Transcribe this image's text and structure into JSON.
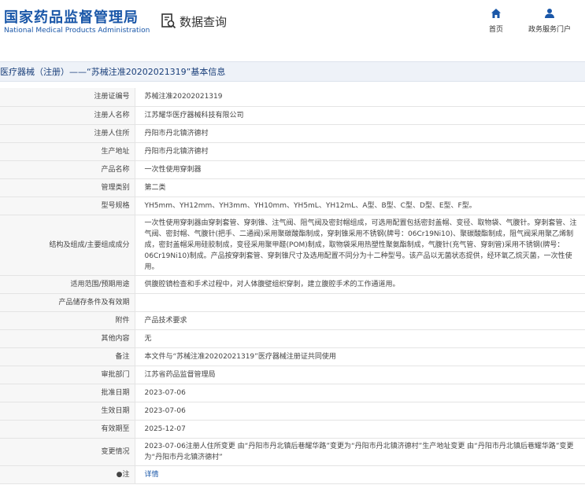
{
  "header": {
    "logo_cn": "国家药品监督管理局",
    "logo_en": "National Medical Products Administration",
    "module_title": "数据查询",
    "nav": [
      {
        "label": "首页",
        "icon": "home-icon"
      },
      {
        "label": "政务服务门户",
        "icon": "user-icon"
      }
    ]
  },
  "breadcrumb": "医疗器械（注册）——“苏械注准20202021319”基本信息",
  "colors": {
    "brand": "#1a57a8",
    "row_label_bg": "#f7f7f7",
    "title_bg": "#eef2f8"
  },
  "rows": [
    {
      "label": "注册证编号",
      "value": "苏械注准20202021319"
    },
    {
      "label": "注册人名称",
      "value": "江苏耀华医疗器械科技有限公司"
    },
    {
      "label": "注册人住所",
      "value": "丹阳市丹北镇济德村"
    },
    {
      "label": "生产地址",
      "value": "丹阳市丹北镇济德村"
    },
    {
      "label": "产品名称",
      "value": "一次性使用穿刺器"
    },
    {
      "label": "管理类别",
      "value": "第二类"
    },
    {
      "label": "型号规格",
      "value": "YH5mm、YH12mm、YH3mm、YH10mm、YH5mL、YH12mL、A型、B型、C型、D型、E型、F型。"
    },
    {
      "label": "结构及组成/主要组成成分",
      "value": "一次性使用穿刺器由穿刺套管、穿刺锥、注气阀、阻气阀及密封帽组成，可选用配置包括密封盖帽、变径、取物袋、气腹针。穿刺套管、注气阀、密封帽、气腹针(把手、二通阀)采用聚碳酸酯制成，穿刺锥采用不锈钢(牌号：06Cr19Ni10)、聚碳酸酯制成，阻气阀采用聚乙烯制成，密封盖帽采用硅胶制成，变径采用聚甲醛(POM)制成，取物袋采用热塑性聚氨酯制成，气腹针(充气管、穿刺管)采用不锈钢(牌号：06Cr19Ni10)制成。产品按穿刺套管、穿刺锥尺寸及选用配置不同分为十二种型号。该产品以无菌状态提供，经环氧乙烷灭菌，一次性使用。"
    },
    {
      "label": "适用范围/预期用途",
      "value": "供腹腔镜检查和手术过程中，对人体腹壁组织穿刺，建立腹腔手术的工作通道用。"
    },
    {
      "label": "产品储存条件及有效期",
      "value": ""
    },
    {
      "label": "附件",
      "value": "产品技术要求"
    },
    {
      "label": "其他内容",
      "value": "无"
    },
    {
      "label": "备注",
      "value": "本文件与“苏械注准20202021319”医疗器械注册证共同使用"
    },
    {
      "label": "审批部门",
      "value": "江苏省药品监督管理局"
    },
    {
      "label": "批准日期",
      "value": "2023-07-06"
    },
    {
      "label": "生效日期",
      "value": "2023-07-06"
    },
    {
      "label": "有效期至",
      "value": "2025-12-07"
    },
    {
      "label": "变更情况",
      "value": "2023-07-06注册人住所变更 由“丹阳市丹北镇后巷耀华路”变更为“丹阳市丹北镇济德村”生产地址变更 由“丹阳市丹北镇后巷耀华路”变更为“丹阳市丹北镇济德村”"
    },
    {
      "label": "●注",
      "value": "详情",
      "link": true
    }
  ]
}
